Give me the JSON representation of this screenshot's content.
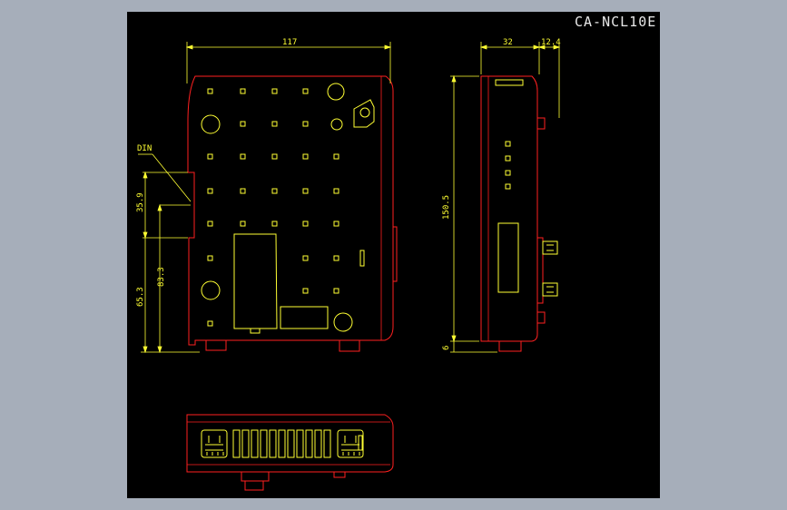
{
  "drawing": {
    "title": "CA-NCL10E",
    "colors": {
      "background": "#a6aeba",
      "canvas": "#000000",
      "outline": "#ff2020",
      "detail": "#ffff33",
      "dimension": "#ffff33",
      "title_text": "#e8e8e8"
    }
  },
  "dims": {
    "width_front": "117",
    "depth_side": "32",
    "side_offset": "12.4",
    "height_total": "150.5",
    "bottom_offset": "6",
    "din_label": "DIN",
    "din_upper": "35.9",
    "din_lower": "65.3",
    "mount_height": "83.3"
  }
}
